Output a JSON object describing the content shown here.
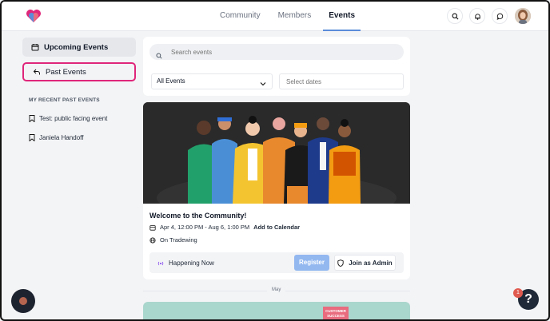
{
  "nav": {
    "items": [
      {
        "label": "Community",
        "active": false
      },
      {
        "label": "Members",
        "active": false
      },
      {
        "label": "Events",
        "active": true
      }
    ]
  },
  "sidebar": {
    "upcoming_label": "Upcoming Events",
    "past_label": "Past Events",
    "recent_heading": "MY RECENT PAST EVENTS",
    "recent_items": [
      {
        "label": "Test: public facing event"
      },
      {
        "label": "Janiela Handoff"
      }
    ]
  },
  "filters": {
    "search_placeholder": "Search events",
    "event_type_value": "All Events",
    "date_placeholder": "Select dates"
  },
  "event": {
    "title": "Welcome to the Community!",
    "date_range": "Apr 4, 12:00 PM - Aug 6, 1:00 PM",
    "add_to_calendar": "Add to Calendar",
    "location": "On Tradewing",
    "status": "Happening Now",
    "register_label": "Register",
    "join_label": "Join as Admin"
  },
  "month_divider": "May",
  "next_event": {
    "tag_text": "CUSTOMER SUCCESS"
  },
  "help": {
    "badge_count": "1",
    "label": "?"
  },
  "colors": {
    "accent": "#5b8cd9",
    "register": "#93b8f0",
    "highlight": "#e0267a"
  }
}
